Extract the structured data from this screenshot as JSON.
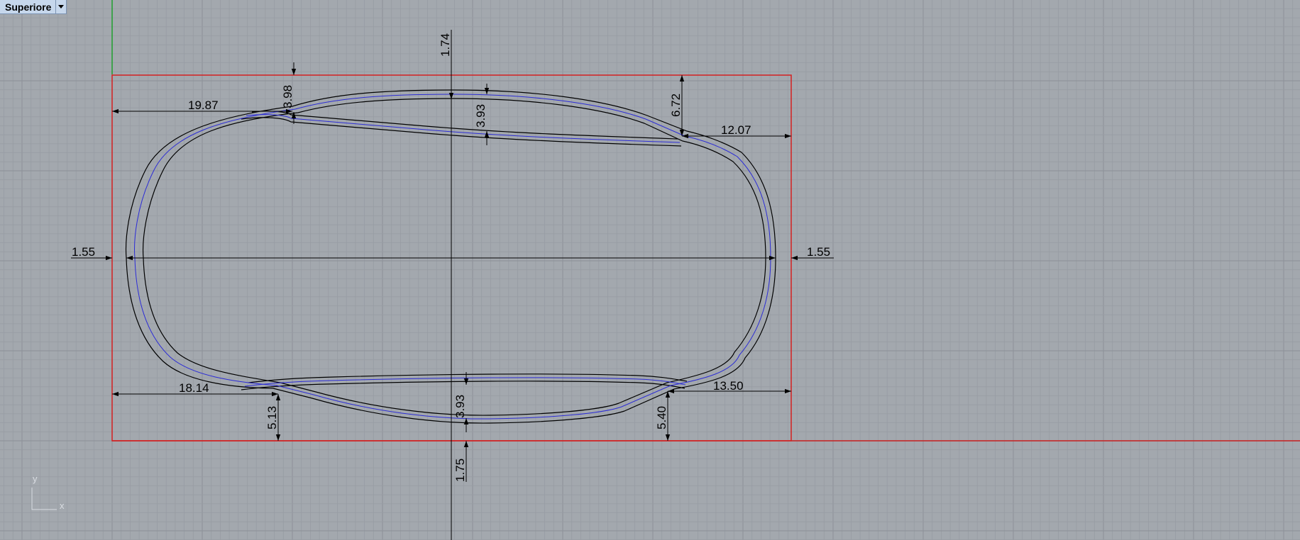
{
  "viewport": {
    "name": "Superiore",
    "grid": true
  },
  "colors": {
    "background": "#a3a8ae",
    "grid_minor": "#979ca3",
    "grid_major": "#8c9198",
    "x_axis": "#c81e1e",
    "y_axis": "#1e9f2e",
    "outline": "#000000",
    "centerline": "#2c2cd6",
    "frame": "#d42020"
  },
  "axes_icon": {
    "x_label": "x",
    "y_label": "y"
  },
  "dimensions": {
    "top_center": "1.74",
    "top_left_thickness": "3.98",
    "top_mid_thickness": "3.93",
    "top_right_height": "6.72",
    "top_left_length": "19.87",
    "top_right_length": "12.07",
    "left_side": "1.55",
    "right_side": "1.55",
    "bottom_left_length": "18.14",
    "bottom_right_length": "13.50",
    "bottom_left_height": "5.13",
    "bottom_mid_thickness": "3.93",
    "bottom_right_height": "5.40",
    "bottom_center": "1.75"
  }
}
